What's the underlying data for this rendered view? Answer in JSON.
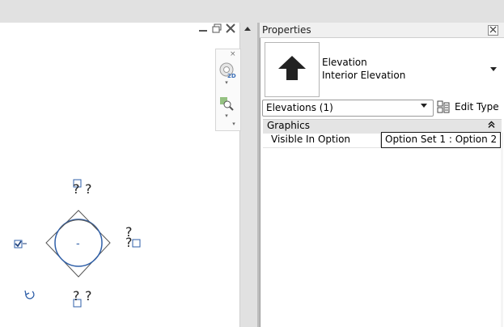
{
  "view": {
    "controls": {
      "minimize_icon": "minimize-icon",
      "restore_icon": "restore-icon",
      "close_icon": "close-icon",
      "scroll_up_icon": "scroll-up-arrow-icon"
    },
    "navbar": {
      "close_glyph": "×",
      "wheel_badge": "2D",
      "arrow_glyph": "▾"
    },
    "symbol": {
      "top_mark": "?",
      "bottom_mark": "?",
      "right_mark": "?",
      "center_mark": "-",
      "qmark_small": "?"
    }
  },
  "properties": {
    "title": "Properties",
    "type_name_line1": "Elevation",
    "type_name_line2": "Interior Elevation",
    "filter_value": "Elevations (1)",
    "edit_type_label": "Edit Type",
    "sections": [
      {
        "label": "Graphics",
        "rows": [
          {
            "label": "Visible In Option",
            "value": "Option Set 1 : Option 2"
          }
        ]
      }
    ]
  },
  "colors": {
    "accent_symbol": "#2f5fa8",
    "panel_bg": "#ffffff",
    "strip_gray": "#e1e1e1"
  }
}
